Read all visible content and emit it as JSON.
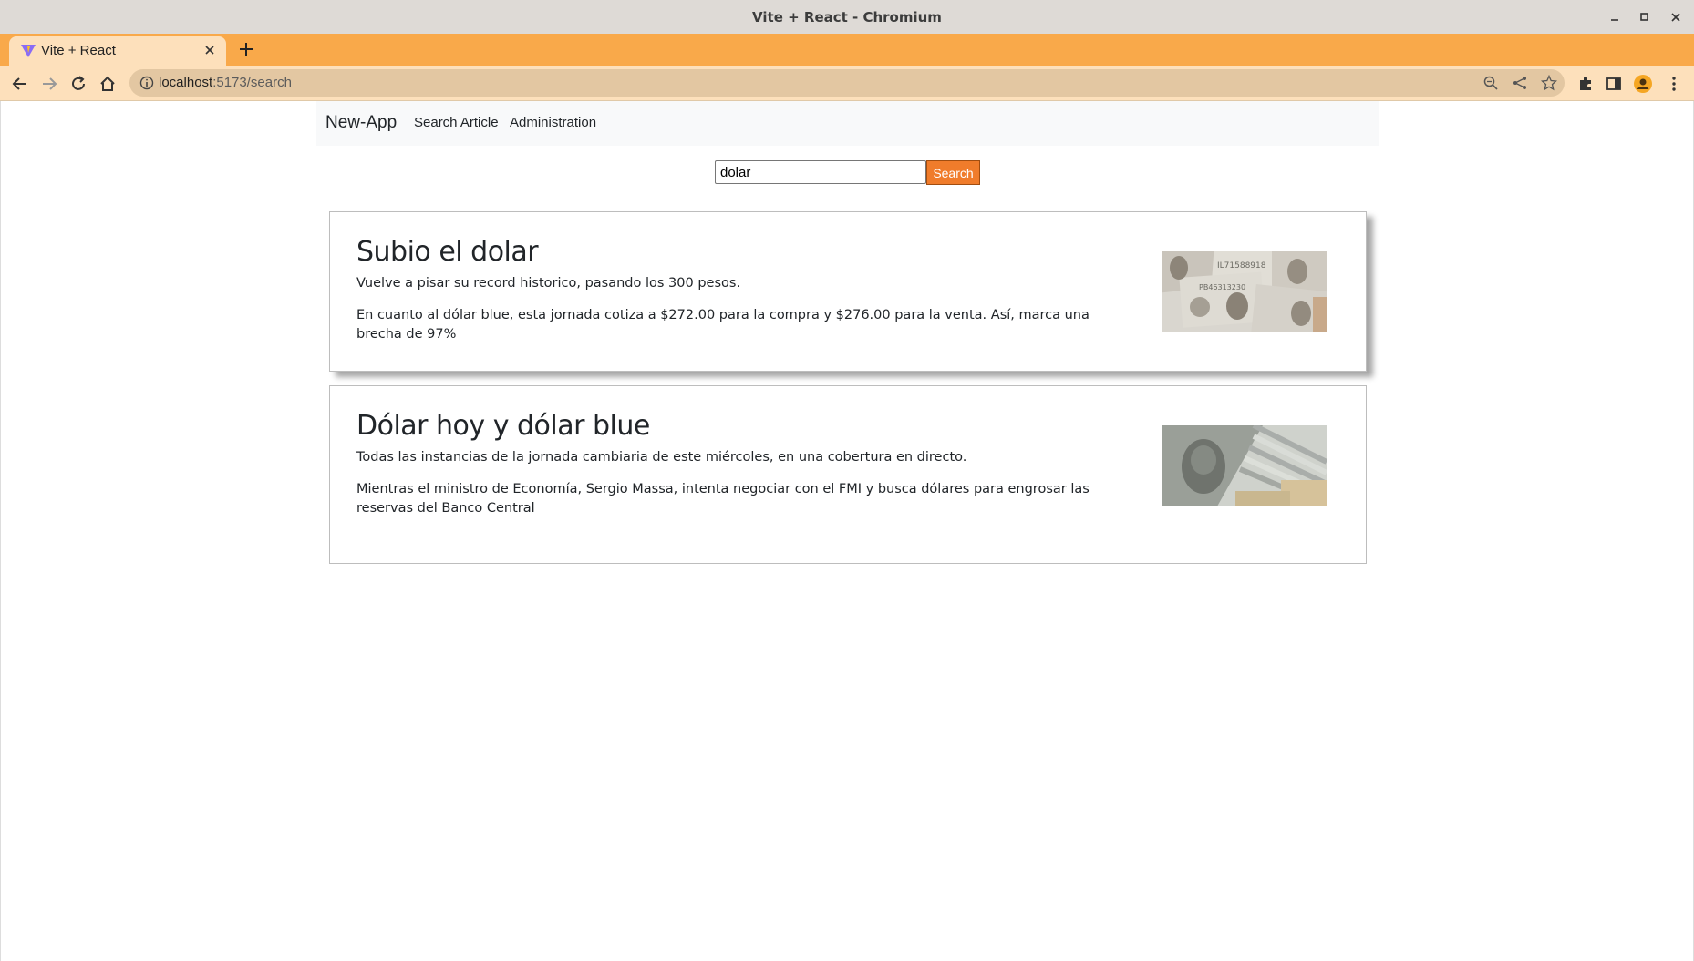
{
  "window": {
    "title": "Vite + React - Chromium"
  },
  "browser": {
    "tab": {
      "title": "Vite + React"
    },
    "url": {
      "host": "localhost",
      "path": ":5173/search"
    }
  },
  "navbar": {
    "brand": "New-App",
    "links": [
      "Search Article",
      "Administration"
    ]
  },
  "search": {
    "value": "dolar",
    "button_label": "Search"
  },
  "articles": [
    {
      "title": "Subio el dolar",
      "subtitle": "Vuelve a pisar su record historico, pasando los 300 pesos.",
      "body": "En cuanto al dólar blue, esta jornada cotiza a $272.00 para la compra y $276.00 para la venta. Así, marca una brecha de 97%"
    },
    {
      "title": "Dólar hoy y dólar blue",
      "subtitle": "Todas las instancias de la jornada cambiaria de este miércoles, en una cobertura en directo.",
      "body": "Mientras el ministro de Economía, Sergio Massa, intenta negociar con el FMI y busca dólares para engrosar las reservas del Banco Central"
    }
  ],
  "colors": {
    "tabstrip": "#f9a94a",
    "toolbar": "#fde0bb",
    "search_button": "#f07c2b"
  }
}
